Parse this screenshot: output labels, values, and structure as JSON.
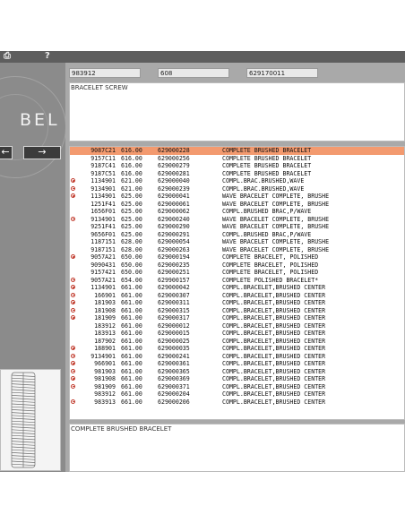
{
  "toolbar": {
    "print_icon": "printer-icon",
    "help_label": "?"
  },
  "logo_text": "BEL",
  "nav": {
    "back_label": "←",
    "forward_label": "→"
  },
  "header_fields": {
    "ref": "983912",
    "price": "608",
    "part": "629170011"
  },
  "description": "BRACELET SCREW",
  "list_rows": [
    {
      "ref": "9087C21",
      "price": "616.00",
      "part": "629000228",
      "desc": "COMPLETE BRUSHED BRACELET",
      "marker": false,
      "selected": true
    },
    {
      "ref": "9157C11",
      "price": "616.00",
      "part": "629000256",
      "desc": "COMPLETE BRUSHED BRACELET",
      "marker": false,
      "selected": false
    },
    {
      "ref": "9187C41",
      "price": "616.00",
      "part": "629000279",
      "desc": "COMPLETE BRUSHED BRACELET",
      "marker": false,
      "selected": false
    },
    {
      "ref": "9187C51",
      "price": "616.00",
      "part": "629000281",
      "desc": "COMPLETE BRUSHED BRACELET",
      "marker": false,
      "selected": false
    },
    {
      "ref": "1134901",
      "price": "621.00",
      "part": "629000040",
      "desc": "COMPL.BRAC.BRUSHED,WAVE",
      "marker": true,
      "selected": false
    },
    {
      "ref": "9134901",
      "price": "621.00",
      "part": "629000239",
      "desc": "COMPL.BRAC.BRUSHED,WAVE",
      "marker": true,
      "selected": false
    },
    {
      "ref": "1134901",
      "price": "625.00",
      "part": "629000041",
      "desc": "WAVE BRACELET COMPLETE, BRUSHE",
      "marker": true,
      "selected": false
    },
    {
      "ref": "1251F41",
      "price": "625.00",
      "part": "629000061",
      "desc": "WAVE BRACELET COMPLETE, BRUSHE",
      "marker": false,
      "selected": false
    },
    {
      "ref": "1656F01",
      "price": "625.00",
      "part": "629000062",
      "desc": "COMPL.BRUSHED BRAC,P/WAVE",
      "marker": false,
      "selected": false
    },
    {
      "ref": "9134901",
      "price": "625.00",
      "part": "629000240",
      "desc": "WAVE BRACELET COMPLETE, BRUSHE",
      "marker": true,
      "selected": false
    },
    {
      "ref": "9251F41",
      "price": "625.00",
      "part": "629000290",
      "desc": "WAVE BRACELET COMPLETE, BRUSHE",
      "marker": false,
      "selected": false
    },
    {
      "ref": "9656F01",
      "price": "625.00",
      "part": "629000291",
      "desc": "COMPL.BRUSHED BRAC,P/WAVE",
      "marker": false,
      "selected": false
    },
    {
      "ref": "1187151",
      "price": "628.00",
      "part": "629000054",
      "desc": "WAVE BRACELET COMPLETE, BRUSHE",
      "marker": false,
      "selected": false
    },
    {
      "ref": "9187151",
      "price": "628.00",
      "part": "629000263",
      "desc": "WAVE BRACELET COMPLETE, BRUSHE",
      "marker": false,
      "selected": false
    },
    {
      "ref": "9057A21",
      "price": "650.00",
      "part": "629000194",
      "desc": "COMPLETE BRACELET, POLISHED",
      "marker": true,
      "selected": false
    },
    {
      "ref": "9090431",
      "price": "650.00",
      "part": "629000235",
      "desc": "COMPLETE BRACELET, POLISHED",
      "marker": false,
      "selected": false
    },
    {
      "ref": "9157421",
      "price": "650.00",
      "part": "629000251",
      "desc": "COMPLETE BRACELET, POLISHED",
      "marker": false,
      "selected": false
    },
    {
      "ref": "9057A21",
      "price": "654.00",
      "part": "629900157",
      "desc": "COMPLETE POLISHED BRACELET*",
      "marker": true,
      "selected": false
    },
    {
      "ref": "1134901",
      "price": "661.00",
      "part": "629000042",
      "desc": "COMPL.BRACELET,BRUSHED CENTER",
      "marker": true,
      "selected": false
    },
    {
      "ref": "166901",
      "price": "661.00",
      "part": "629000307",
      "desc": "COMPL.BRACELET,BRUSHED CENTER",
      "marker": true,
      "selected": false
    },
    {
      "ref": "181903",
      "price": "661.00",
      "part": "629000311",
      "desc": "COMPL.BRACELET,BRUSHED CENTER",
      "marker": true,
      "selected": false
    },
    {
      "ref": "181908",
      "price": "661.00",
      "part": "629000315",
      "desc": "COMPL.BRACELET,BRUSHED CENTER",
      "marker": true,
      "selected": false
    },
    {
      "ref": "181909",
      "price": "661.00",
      "part": "629000317",
      "desc": "COMPL.BRACELET,BRUSHED CENTER",
      "marker": true,
      "selected": false
    },
    {
      "ref": "183912",
      "price": "661.00",
      "part": "629000012",
      "desc": "COMPL.BRACELET,BRUSHED CENTER",
      "marker": false,
      "selected": false
    },
    {
      "ref": "183913",
      "price": "661.00",
      "part": "629000015",
      "desc": "COMPL.BRACELET,BRUSHED CENTER",
      "marker": false,
      "selected": false
    },
    {
      "ref": "187902",
      "price": "661.00",
      "part": "629000025",
      "desc": "COMPL.BRACELET,BRUSHED CENTER",
      "marker": false,
      "selected": false
    },
    {
      "ref": "188901",
      "price": "661.00",
      "part": "629000035",
      "desc": "COMPL.BRACELET,BRUSHED CENTER",
      "marker": true,
      "selected": false
    },
    {
      "ref": "9134901",
      "price": "661.00",
      "part": "629000241",
      "desc": "COMPL.BRACELET,BRUSHED CENTER",
      "marker": true,
      "selected": false
    },
    {
      "ref": "966901",
      "price": "661.00",
      "part": "629000361",
      "desc": "COMPL.BRACELET,BRUSHED CENTER",
      "marker": true,
      "selected": false
    },
    {
      "ref": "981903",
      "price": "661.00",
      "part": "629000365",
      "desc": "COMPL.BRACELET,BRUSHED CENTER",
      "marker": true,
      "selected": false
    },
    {
      "ref": "981908",
      "price": "661.00",
      "part": "629000369",
      "desc": "COMPL.BRACELET,BRUSHED CENTER",
      "marker": true,
      "selected": false
    },
    {
      "ref": "981909",
      "price": "661.00",
      "part": "629000371",
      "desc": "COMPL.BRACELET,BRUSHED CENTER",
      "marker": true,
      "selected": false
    },
    {
      "ref": "983912",
      "price": "661.00",
      "part": "629000204",
      "desc": "COMPL.BRACELET,BRUSHED CENTER",
      "marker": false,
      "selected": false
    },
    {
      "ref": "983913",
      "price": "661.00",
      "part": "629000206",
      "desc": "COMPL.BRACELET,BRUSHED CENTER",
      "marker": true,
      "selected": false
    }
  ],
  "footer_text": "COMPLETE BRUSHED BRACELET",
  "colors": {
    "selected_row": "#f39a6f",
    "marker": "#c0392b",
    "panel": "#8b8b8b"
  }
}
